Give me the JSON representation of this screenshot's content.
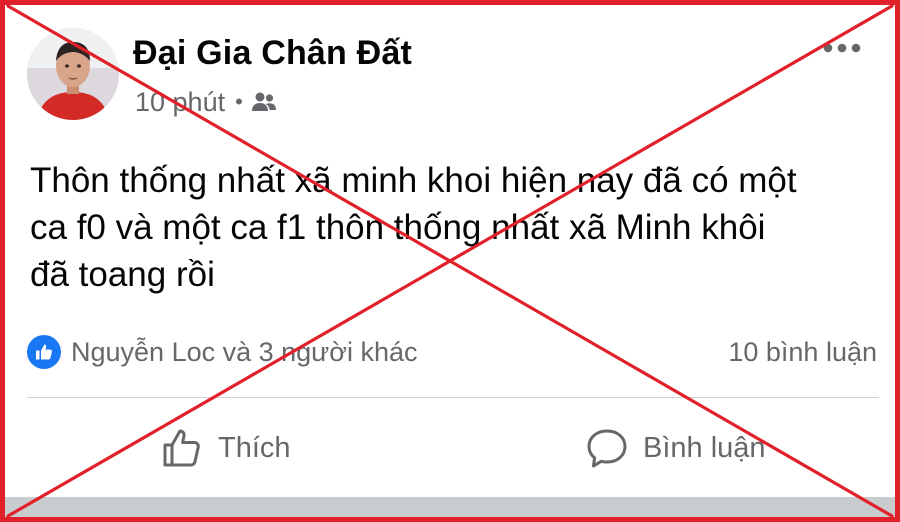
{
  "post": {
    "author": "Đại Gia Chân Đất",
    "time": "10 phút",
    "separator": "•",
    "audience_icon": "friends-icon",
    "text_lines": [
      "Thôn thống nhất xã minh khoi hiện nay đã có một",
      "ca f0 và một ca f1 thôn thống nhất xã Minh khôi",
      "đã toang rồi"
    ]
  },
  "reactions": {
    "icon": "like-icon",
    "names": "Nguyễn Loc và 3 người khác",
    "comments": "10 bình luận"
  },
  "actions": {
    "like_label": "Thích",
    "comment_label": "Bình luận"
  },
  "colors": {
    "overlay_red": "#e1202a",
    "facebook_blue": "#1877f2",
    "secondary_text": "#65676b",
    "primary_text": "#050505"
  }
}
